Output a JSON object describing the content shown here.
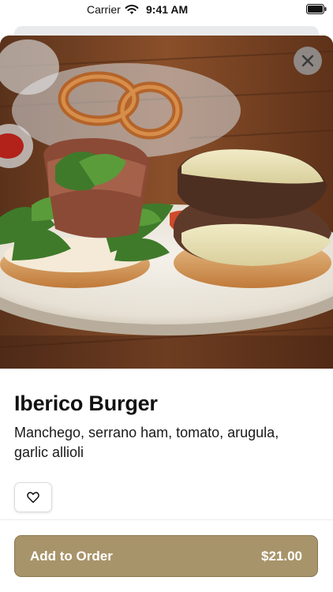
{
  "status_bar": {
    "carrier": "Carrier",
    "time": "9:41 AM",
    "wifi_icon": "wifi-icon",
    "battery_icon": "battery-icon"
  },
  "hero": {
    "image": "photo of burger with serrano ham and arugula on a plate",
    "close_icon": "close-icon"
  },
  "item": {
    "title": "Iberico Burger",
    "description": "Manchego, serrano ham, tomato, arugula, garlic allioli"
  },
  "favorite": {
    "icon": "heart-icon"
  },
  "order_button": {
    "label": "Add to Order",
    "price": "$21.00"
  },
  "colors": {
    "accent": "#a8946a",
    "accent_border": "#8a774f",
    "close_bg": "#969696"
  }
}
